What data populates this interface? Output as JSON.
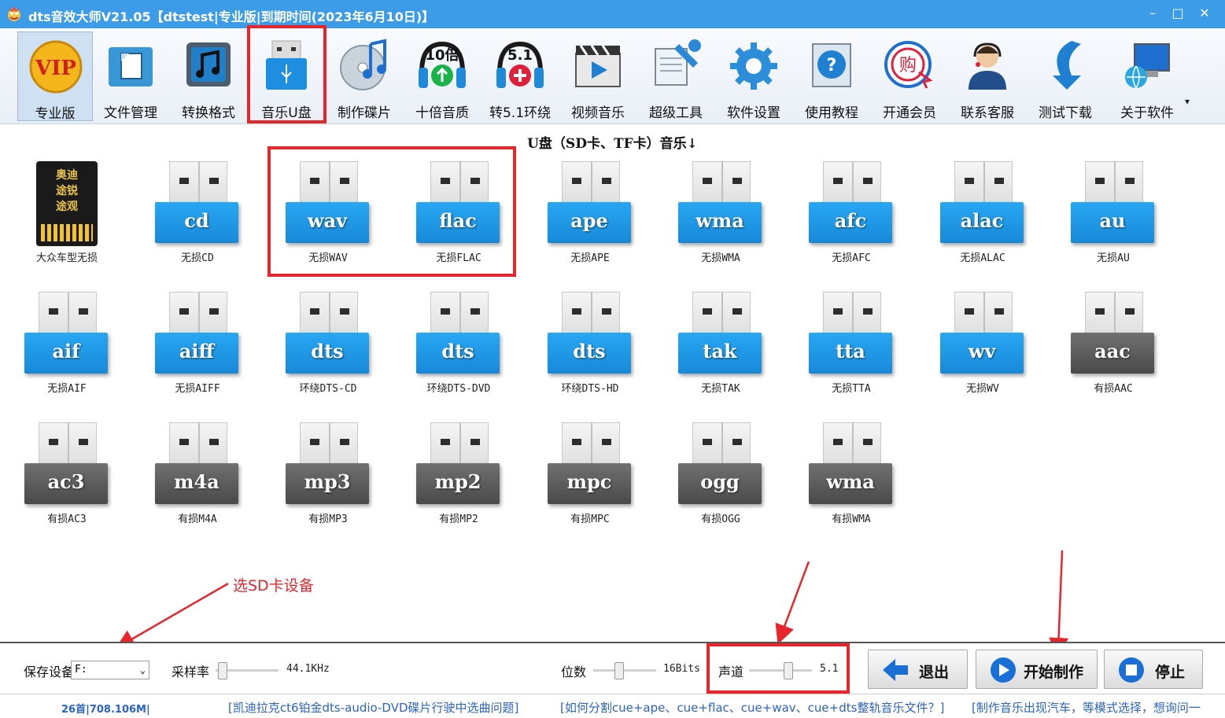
{
  "window": {
    "title": "dts音效大师V21.05【dtstest|专业版|到期时间(2023年6月10日)】",
    "controls": [
      "–",
      "□",
      "✕"
    ]
  },
  "toolbar": {
    "items": [
      {
        "label": "专业版",
        "icon": "vip-icon"
      },
      {
        "label": "文件管理",
        "icon": "file-folder-icon"
      },
      {
        "label": "转换格式",
        "icon": "music-note-icon"
      },
      {
        "label": "音乐U盘",
        "icon": "usb-drive-icon"
      },
      {
        "label": "制作碟片",
        "icon": "cd-disc-icon"
      },
      {
        "label": "十倍音质",
        "icon": "headphones-10x-icon",
        "badge": "10倍"
      },
      {
        "label": "转5.1环绕",
        "icon": "headphones-51-icon",
        "badge": "5.1"
      },
      {
        "label": "视频音乐",
        "icon": "video-clapper-icon"
      },
      {
        "label": "超级工具",
        "icon": "tools-icon"
      },
      {
        "label": "软件设置",
        "icon": "gear-icon"
      },
      {
        "label": "使用教程",
        "icon": "help-icon"
      },
      {
        "label": "开通会员",
        "icon": "shop-icon",
        "badge": "购"
      },
      {
        "label": "联系客服",
        "icon": "support-agent-icon"
      },
      {
        "label": "测试下载",
        "icon": "download-arrow-icon"
      },
      {
        "label": "关于软件",
        "icon": "computer-globe-icon"
      }
    ],
    "dropdown": "▾"
  },
  "section_title": "U盘（SD卡、TF卡）音乐↓",
  "formats": [
    {
      "label": "",
      "caption": "大众车型无损",
      "style": "sdcard",
      "card_text": "奥迪\n途锐\n途观"
    },
    {
      "label": "cd",
      "caption": "无损CD",
      "style": "blue"
    },
    {
      "label": "wav",
      "caption": "无损WAV",
      "style": "blue"
    },
    {
      "label": "flac",
      "caption": "无损FLAC",
      "style": "blue"
    },
    {
      "label": "ape",
      "caption": "无损APE",
      "style": "blue"
    },
    {
      "label": "wma",
      "caption": "无损WMA",
      "style": "blue"
    },
    {
      "label": "afc",
      "caption": "无损AFC",
      "style": "blue"
    },
    {
      "label": "alac",
      "caption": "无损ALAC",
      "style": "blue"
    },
    {
      "label": "au",
      "caption": "无损AU",
      "style": "blue"
    },
    {
      "label": "aif",
      "caption": "无损AIF",
      "style": "blue"
    },
    {
      "label": "aiff",
      "caption": "无损AIFF",
      "style": "blue"
    },
    {
      "label": "dts",
      "caption": "环绕DTS-CD",
      "style": "blue"
    },
    {
      "label": "dts",
      "caption": "环绕DTS-DVD",
      "style": "blue"
    },
    {
      "label": "dts",
      "caption": "环绕DTS-HD",
      "style": "blue"
    },
    {
      "label": "tak",
      "caption": "无损TAK",
      "style": "blue"
    },
    {
      "label": "tta",
      "caption": "无损TTA",
      "style": "blue"
    },
    {
      "label": "wv",
      "caption": "无损WV",
      "style": "blue"
    },
    {
      "label": "aac",
      "caption": "有损AAC",
      "style": "gray"
    },
    {
      "label": "ac3",
      "caption": "有损AC3",
      "style": "gray"
    },
    {
      "label": "m4a",
      "caption": "有损M4A",
      "style": "gray"
    },
    {
      "label": "mp3",
      "caption": "有损MP3",
      "style": "gray"
    },
    {
      "label": "mp2",
      "caption": "有损MP2",
      "style": "gray"
    },
    {
      "label": "mpc",
      "caption": "有损MPC",
      "style": "gray"
    },
    {
      "label": "ogg",
      "caption": "有损OGG",
      "style": "gray"
    },
    {
      "label": "wma",
      "caption": "有损WMA",
      "style": "gray"
    }
  ],
  "annotation": {
    "text": "选SD卡设备"
  },
  "settings": {
    "save_device_label": "保存设备",
    "save_device_value": "F:",
    "sample_rate_label": "采样率",
    "sample_rate_value": "44.1KHz",
    "sample_rate_level": 0.05,
    "bits_label": "位数",
    "bits_value": "16Bits",
    "bits_level": 0.4,
    "channels_label": "声道",
    "channels_value": "5.1",
    "channels_level": 0.65
  },
  "buttons": {
    "exit": "退出",
    "start": "开始制作",
    "stop": "停止"
  },
  "status": {
    "count": "26首|708.106M|",
    "link1": "[凯迪拉克ct6铂金dts-audio-DVD碟片行驶中选曲问题]",
    "link2": "[如何分割cue+ape、cue+flac、cue+wav、cue+dts整轨音乐文件？]",
    "link3": "[制作音乐出现汽车，等模式选择，想询问一"
  },
  "colors": {
    "titlebar": "#3d9ce8",
    "highlight_red": "#e8252b",
    "lossless_blue": "#1e96e6",
    "lossy_gray": "#5a5a5a",
    "link_blue": "#2a63c9"
  }
}
